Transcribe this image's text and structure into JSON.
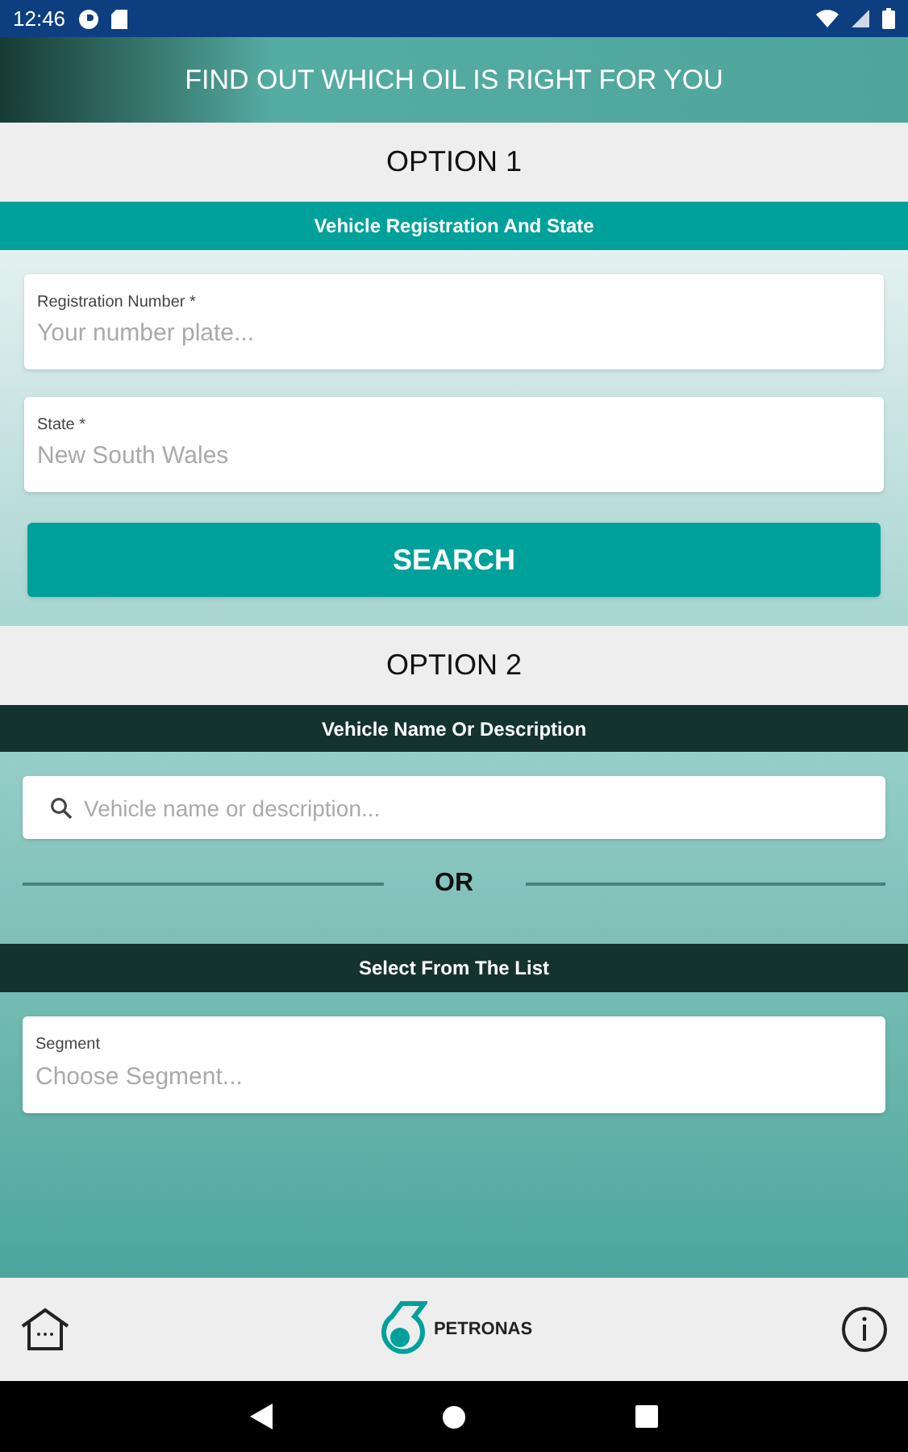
{
  "status_bar": {
    "time": "12:46"
  },
  "header": {
    "title": "FIND OUT WHICH OIL IS RIGHT FOR YOU"
  },
  "option_1": {
    "title": "OPTION 1",
    "section": "Vehicle Registration And State",
    "fields": [
      {
        "label": "Registration Number *",
        "placeholder": "Your number plate..."
      },
      {
        "label": "State *",
        "placeholder": "New South Wales"
      }
    ],
    "button": "SEARCH"
  },
  "option_2": {
    "title": "OPTION 2",
    "section": "Vehicle Name Or Description",
    "search": {
      "placeholder": "Vehicle name or description..."
    },
    "divider": "OR",
    "list_section": "Select From The List",
    "segment": {
      "label": "Segment",
      "placeholder": "Choose Segment..."
    }
  },
  "bottom_bar": {
    "brand": "PETRONAS"
  }
}
